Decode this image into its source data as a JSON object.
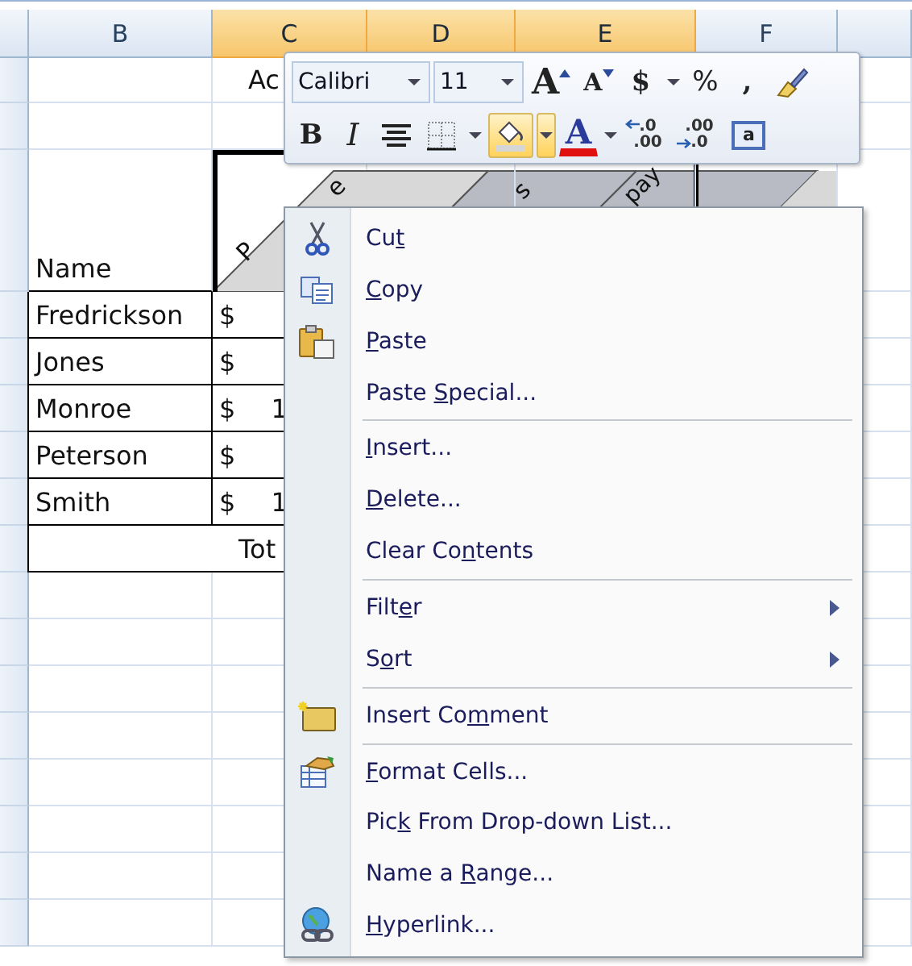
{
  "sheet": {
    "column_headers": [
      {
        "label": "B",
        "selected": false
      },
      {
        "label": "C",
        "selected": true
      },
      {
        "label": "D",
        "selected": true
      },
      {
        "label": "E",
        "selected": true
      },
      {
        "label": "F",
        "selected": false
      }
    ],
    "title_fragment": "Ac",
    "header_fragments": [
      "P",
      "e",
      "s",
      "pay"
    ],
    "name_header": "Name",
    "rows": [
      {
        "name": "Fredrickson",
        "currency": "$"
      },
      {
        "name": "Jones",
        "currency": "$"
      },
      {
        "name": "Monroe",
        "currency": "$",
        "amount": "1"
      },
      {
        "name": "Peterson",
        "currency": "$"
      },
      {
        "name": "Smith",
        "currency": "$",
        "amount": "1"
      }
    ],
    "total_label": "Tot"
  },
  "mini_toolbar": {
    "font": "Calibri",
    "size": "11",
    "row_1": [
      {
        "kind": "grow",
        "label": "A",
        "highlighted": false
      },
      {
        "kind": "shrink",
        "label": "A",
        "highlighted": false
      },
      {
        "kind": "currency",
        "label": "$",
        "highlighted": false
      },
      {
        "kind": "dropdown",
        "highlighted": false
      },
      {
        "kind": "percent",
        "label": "%",
        "highlighted": false
      },
      {
        "kind": "comma",
        "label": ",",
        "highlighted": false
      },
      {
        "kind": "painter",
        "highlighted": false
      }
    ],
    "row_2": [
      {
        "kind": "bold",
        "label": "B",
        "highlighted": false
      },
      {
        "kind": "italic",
        "label": "I",
        "highlighted": false
      },
      {
        "kind": "center",
        "highlighted": false
      },
      {
        "kind": "borders",
        "highlighted": false
      },
      {
        "kind": "dropdown",
        "highlighted": false
      },
      {
        "kind": "fill",
        "highlighted": true
      },
      {
        "kind": "dropdown",
        "highlighted": true
      },
      {
        "kind": "fontcolor",
        "label": "A",
        "highlighted": false
      },
      {
        "kind": "dropdown",
        "highlighted": false
      },
      {
        "kind": "increase-decimal",
        "top": ".0",
        "bottom": ".00",
        "highlighted": false
      },
      {
        "kind": "decrease-decimal",
        "top": ".00",
        "bottom": ".0",
        "highlighted": false
      },
      {
        "kind": "merge",
        "label": "a",
        "highlighted": false
      }
    ]
  },
  "context_menu": {
    "groups": [
      [
        {
          "kind": "cut",
          "pre": "Cu",
          "key": "t",
          "submenu": false
        },
        {
          "kind": "copy",
          "key": "C",
          "post": "opy",
          "submenu": false
        },
        {
          "kind": "paste",
          "key": "P",
          "post": "aste",
          "submenu": false
        },
        {
          "kind": "plain",
          "pre": "Paste ",
          "key": "S",
          "post": "pecial...",
          "submenu": false
        }
      ],
      [
        {
          "kind": "plain",
          "key": "I",
          "post": "nsert...",
          "submenu": false
        },
        {
          "kind": "plain",
          "key": "D",
          "post": "elete...",
          "submenu": false
        },
        {
          "kind": "plain",
          "pre": "Clear Co",
          "key": "n",
          "post": "tents",
          "submenu": false
        }
      ],
      [
        {
          "kind": "plain",
          "pre": "Filt",
          "key": "e",
          "post": "r",
          "submenu": true
        },
        {
          "kind": "plain",
          "pre": "S",
          "key": "o",
          "post": "rt",
          "submenu": true
        }
      ],
      [
        {
          "kind": "comment",
          "pre": "Insert Co",
          "key": "m",
          "post": "ment",
          "submenu": false
        }
      ],
      [
        {
          "kind": "format",
          "key": "F",
          "post": "ormat Cells...",
          "submenu": false
        },
        {
          "kind": "plain",
          "pre": "Pic",
          "key": "k",
          "post": " From Drop-down List...",
          "submenu": false
        },
        {
          "kind": "plain",
          "pre": "Name a ",
          "key": "R",
          "post": "ange...",
          "submenu": false
        },
        {
          "kind": "link",
          "key": "H",
          "post": "yperlink...",
          "submenu": false
        }
      ]
    ]
  }
}
